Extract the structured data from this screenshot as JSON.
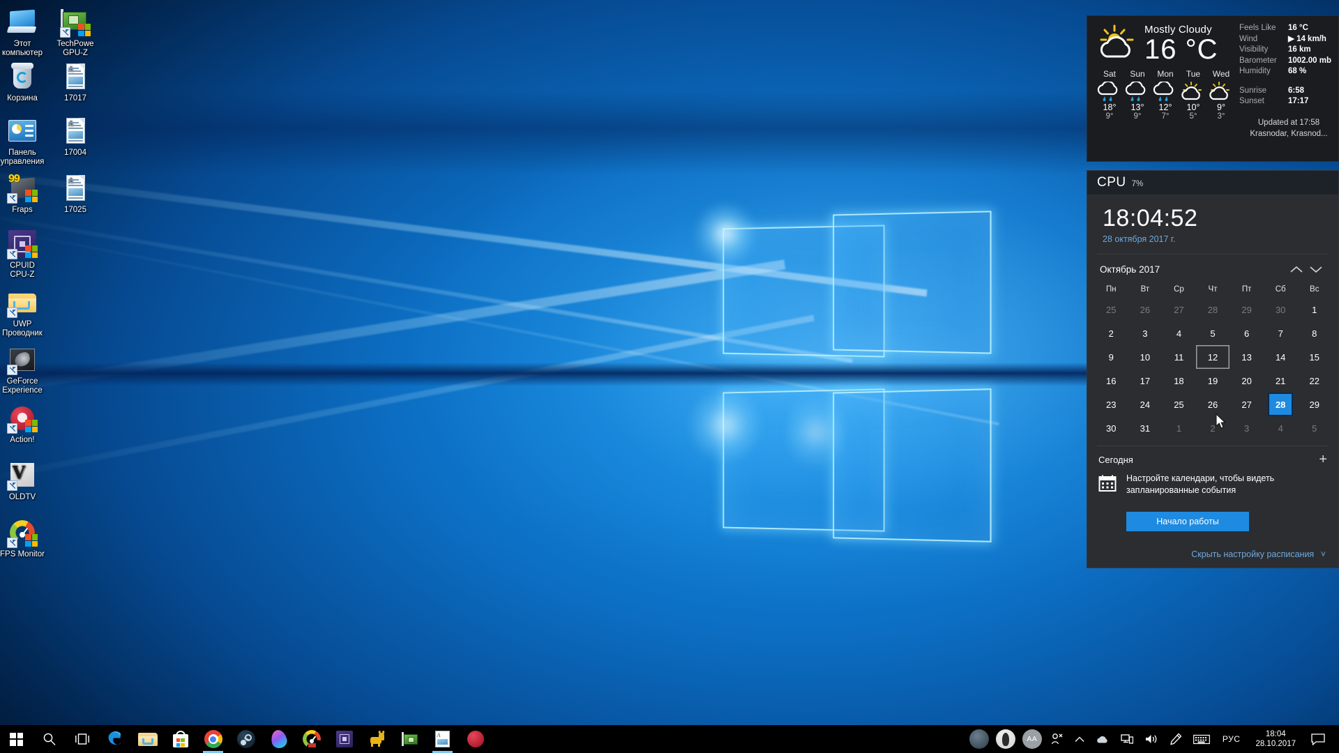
{
  "desktop": {
    "icons": [
      {
        "label": "Этот компьютер",
        "icon": "this-pc-icon"
      },
      {
        "label": "Корзина",
        "icon": "recycle-bin-icon"
      },
      {
        "label": "Панель управления",
        "icon": "control-panel-icon"
      },
      {
        "label": "Fraps",
        "icon": "fraps-icon"
      },
      {
        "label": "CPUID CPU-Z",
        "icon": "cpuid-cpuz-icon"
      },
      {
        "label": "UWP Проводник",
        "icon": "folder-icon"
      },
      {
        "label": "GeForce Experience",
        "icon": "geforce-experience-icon"
      },
      {
        "label": "Action!",
        "icon": "action-recorder-icon"
      },
      {
        "label": "OLDTV",
        "icon": "oldtv-icon"
      },
      {
        "label": "FPS Monitor",
        "icon": "fps-monitor-icon"
      },
      {
        "label": "TechPowe GPU-Z",
        "icon": "gpuz-icon"
      },
      {
        "label": "17017",
        "icon": "document-icon"
      },
      {
        "label": "17004",
        "icon": "document-icon"
      },
      {
        "label": "17025",
        "icon": "document-icon"
      }
    ]
  },
  "weather": {
    "condition": "Mostly Cloudy",
    "temperature": "16 °C",
    "icon": "partly-sunny-icon",
    "details": [
      {
        "key": "Feels Like",
        "value": "16 °C"
      },
      {
        "key": "Wind",
        "value": "14 km/h"
      },
      {
        "key": "Visibility",
        "value": "16 km"
      },
      {
        "key": "Barometer",
        "value": "1002.00 mb"
      },
      {
        "key": "Humidity",
        "value": "68 %"
      }
    ],
    "sun": [
      {
        "key": "Sunrise",
        "value": "6:58"
      },
      {
        "key": "Sunset",
        "value": "17:17"
      }
    ],
    "updated": "Updated at 17:58",
    "location": "Krasnodar, Krasnod...",
    "forecast": [
      {
        "day": "Sat",
        "icon": "rain-icon",
        "high": "18°",
        "low": "9°"
      },
      {
        "day": "Sun",
        "icon": "rain-icon",
        "high": "13°",
        "low": "9°"
      },
      {
        "day": "Mon",
        "icon": "rain-icon",
        "high": "12°",
        "low": "7°"
      },
      {
        "day": "Tue",
        "icon": "partly-sunny-icon",
        "high": "10°",
        "low": "5°"
      },
      {
        "day": "Wed",
        "icon": "partly-sunny-icon",
        "high": "9°",
        "low": "3°"
      }
    ]
  },
  "cpu": {
    "label": "CPU",
    "usage": "7%"
  },
  "clock": {
    "time": "18:04:52",
    "date": "28 октября 2017 г."
  },
  "calendar": {
    "month_title": "Октябрь 2017",
    "prev_icon": "chevron-up-icon",
    "next_icon": "chevron-down-icon",
    "weekdays": [
      "Пн",
      "Вт",
      "Ср",
      "Чт",
      "Пт",
      "Сб",
      "Вс"
    ],
    "weeks": [
      [
        {
          "d": "25",
          "o": true
        },
        {
          "d": "26",
          "o": true
        },
        {
          "d": "27",
          "o": true
        },
        {
          "d": "28",
          "o": true
        },
        {
          "d": "29",
          "o": true
        },
        {
          "d": "30",
          "o": true
        },
        {
          "d": "1"
        }
      ],
      [
        {
          "d": "2"
        },
        {
          "d": "3"
        },
        {
          "d": "4"
        },
        {
          "d": "5"
        },
        {
          "d": "6"
        },
        {
          "d": "7"
        },
        {
          "d": "8"
        }
      ],
      [
        {
          "d": "9"
        },
        {
          "d": "10"
        },
        {
          "d": "11"
        },
        {
          "d": "12",
          "hover": true
        },
        {
          "d": "13"
        },
        {
          "d": "14"
        },
        {
          "d": "15"
        }
      ],
      [
        {
          "d": "16"
        },
        {
          "d": "17"
        },
        {
          "d": "18"
        },
        {
          "d": "19"
        },
        {
          "d": "20"
        },
        {
          "d": "21"
        },
        {
          "d": "22"
        }
      ],
      [
        {
          "d": "23"
        },
        {
          "d": "24"
        },
        {
          "d": "25"
        },
        {
          "d": "26"
        },
        {
          "d": "27"
        },
        {
          "d": "28",
          "today": true
        },
        {
          "d": "29"
        }
      ],
      [
        {
          "d": "30"
        },
        {
          "d": "31"
        },
        {
          "d": "1",
          "o": true
        },
        {
          "d": "2",
          "o": true
        },
        {
          "d": "3",
          "o": true
        },
        {
          "d": "4",
          "o": true
        },
        {
          "d": "5",
          "o": true
        }
      ]
    ],
    "today_value": "28"
  },
  "agenda": {
    "title": "Сегодня",
    "add_icon": "plus-icon",
    "calendar_icon": "calendar-icon",
    "message": "Настройте календари, чтобы видеть запланированные события",
    "button_label": "Начало работы",
    "hide_link": "Скрыть настройку расписания",
    "hide_chevron": "chevron-down-icon"
  },
  "taskbar": {
    "items": [
      {
        "name": "start-button",
        "icon": "windows-logo-icon"
      },
      {
        "name": "search-button",
        "icon": "search-icon"
      },
      {
        "name": "task-view-button",
        "icon": "task-view-icon"
      },
      {
        "name": "edge-button",
        "icon": "edge-icon"
      },
      {
        "name": "file-explorer-button",
        "icon": "folder-icon"
      },
      {
        "name": "microsoft-store-button",
        "icon": "store-icon"
      },
      {
        "name": "chrome-button",
        "icon": "chrome-icon",
        "active": true
      },
      {
        "name": "steam-button",
        "icon": "steam-icon"
      },
      {
        "name": "paint3d-button",
        "icon": "paint-3d-icon"
      },
      {
        "name": "fps-monitor-button",
        "icon": "fps-monitor-icon"
      },
      {
        "name": "cpuz-button",
        "icon": "cpuid-cpuz-icon"
      },
      {
        "name": "donkey-button",
        "icon": "donkey-icon"
      },
      {
        "name": "gpuz-button",
        "icon": "gpuz-icon"
      },
      {
        "name": "document-button",
        "icon": "document-icon",
        "active": true
      },
      {
        "name": "action-recorder-button",
        "icon": "action-recorder-icon"
      }
    ],
    "tray": {
      "people": [
        {
          "name": "people-avatar-1"
        },
        {
          "name": "people-avatar-2"
        },
        {
          "name": "people-avatar-initials",
          "text": "AA"
        }
      ],
      "people_icon": "people-icon",
      "icons": [
        {
          "name": "show-hidden-icons",
          "icon": "chevron-up-icon"
        },
        {
          "name": "onedrive-icon",
          "icon": "cloud-icon"
        },
        {
          "name": "network-icon",
          "icon": "network-icon"
        },
        {
          "name": "volume-icon",
          "icon": "speaker-icon"
        },
        {
          "name": "pen-workspace-icon",
          "icon": "pen-icon"
        },
        {
          "name": "touch-keyboard-icon",
          "icon": "keyboard-icon"
        }
      ],
      "language": "РУС",
      "time": "18:04",
      "date": "28.10.2017",
      "action_center_icon": "action-center-icon"
    }
  }
}
